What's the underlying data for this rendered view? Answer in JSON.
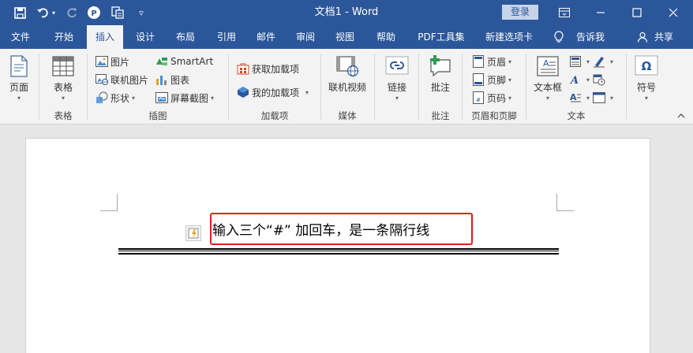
{
  "titlebar": {
    "title": "文档1 - Word",
    "login": "登录",
    "colors": {
      "bg": "#2b579a",
      "login_bg": "#c7d3e8"
    }
  },
  "tabs": [
    {
      "label": "文件"
    },
    {
      "label": "开始"
    },
    {
      "label": "插入",
      "active": true
    },
    {
      "label": "设计"
    },
    {
      "label": "布局"
    },
    {
      "label": "引用"
    },
    {
      "label": "邮件"
    },
    {
      "label": "审阅"
    },
    {
      "label": "视图"
    },
    {
      "label": "帮助"
    },
    {
      "label": "PDF工具集"
    },
    {
      "label": "新建选项卡"
    }
  ],
  "tell_me": "告诉我",
  "share": "共享",
  "ribbon": {
    "pages": {
      "button": "页面",
      "label": ""
    },
    "tables": {
      "button": "表格",
      "label": "表格"
    },
    "illustrations": {
      "label": "插图",
      "picture": "图片",
      "online_picture": "联机图片",
      "shapes": "形状",
      "smartart": "SmartArt",
      "chart": "图表",
      "screenshot": "屏幕截图"
    },
    "addins": {
      "label": "加载项",
      "get_addins": "获取加载项",
      "my_addins": "我的加载项"
    },
    "media": {
      "label": "媒体",
      "online_video": "联机视频"
    },
    "links": {
      "button": "链接"
    },
    "comments": {
      "label": "批注",
      "button": "批注"
    },
    "header_footer": {
      "label": "页眉和页脚",
      "header": "页眉",
      "footer": "页脚",
      "page_number": "页码"
    },
    "text": {
      "label": "文本",
      "textbox": "文本框"
    },
    "symbols": {
      "button": "符号"
    }
  },
  "document": {
    "text": "输入三个“#” 加回车，是一条隔行线",
    "highlight_color": "#e0201a"
  }
}
